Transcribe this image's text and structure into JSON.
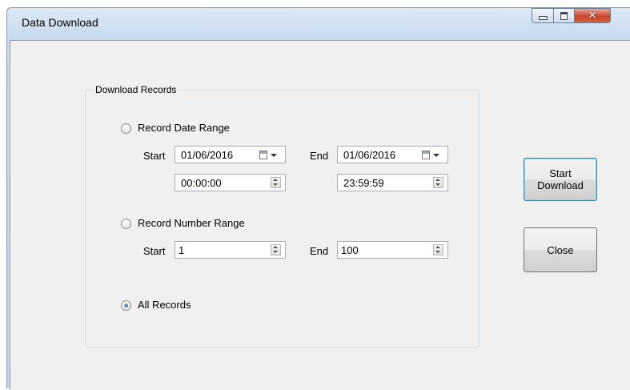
{
  "window": {
    "title": "Data Download"
  },
  "group": {
    "title": "Download Records",
    "date_range": {
      "label": "Record Date Range",
      "selected": false,
      "start_label": "Start",
      "end_label": "End",
      "start_date": "01/06/2016",
      "end_date": "01/06/2016",
      "start_time": "00:00:00",
      "end_time": "23:59:59"
    },
    "number_range": {
      "label": "Record Number Range",
      "selected": false,
      "start_label": "Start",
      "end_label": "End",
      "start_value": "1",
      "end_value": "100"
    },
    "all_records": {
      "label": "All Records",
      "selected": true
    }
  },
  "buttons": {
    "start_download_line1": "Start",
    "start_download_line2": "Download",
    "close": "Close"
  }
}
